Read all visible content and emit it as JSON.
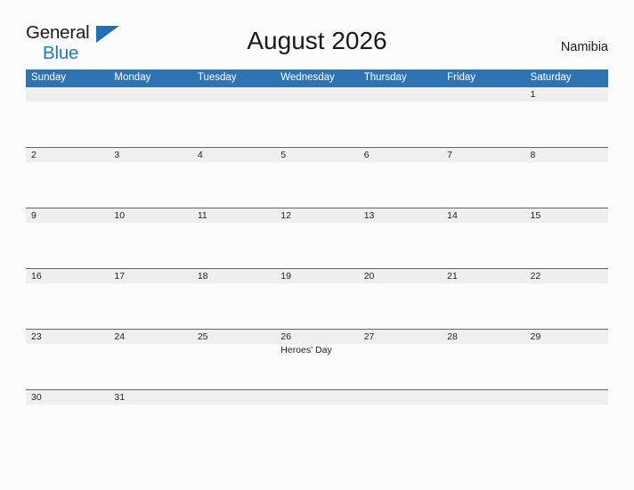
{
  "brand": {
    "word_one": "General",
    "word_two": "Blue"
  },
  "header": {
    "title": "August 2026",
    "country": "Namibia"
  },
  "colors": {
    "header_blue": "#2e74b5",
    "date_band_gray": "#efefef",
    "brand_blue": "#1f7ac4",
    "page_background": "#fcfcfd",
    "text": "#1e1e1e"
  },
  "weekdays": [
    "Sunday",
    "Monday",
    "Tuesday",
    "Wednesday",
    "Thursday",
    "Friday",
    "Saturday"
  ],
  "weeks": [
    {
      "days": [
        {
          "date": "",
          "event": ""
        },
        {
          "date": "",
          "event": ""
        },
        {
          "date": "",
          "event": ""
        },
        {
          "date": "",
          "event": ""
        },
        {
          "date": "",
          "event": ""
        },
        {
          "date": "",
          "event": ""
        },
        {
          "date": "1",
          "event": ""
        }
      ]
    },
    {
      "days": [
        {
          "date": "2",
          "event": ""
        },
        {
          "date": "3",
          "event": ""
        },
        {
          "date": "4",
          "event": ""
        },
        {
          "date": "5",
          "event": ""
        },
        {
          "date": "6",
          "event": ""
        },
        {
          "date": "7",
          "event": ""
        },
        {
          "date": "8",
          "event": ""
        }
      ]
    },
    {
      "days": [
        {
          "date": "9",
          "event": ""
        },
        {
          "date": "10",
          "event": ""
        },
        {
          "date": "11",
          "event": ""
        },
        {
          "date": "12",
          "event": ""
        },
        {
          "date": "13",
          "event": ""
        },
        {
          "date": "14",
          "event": ""
        },
        {
          "date": "15",
          "event": ""
        }
      ]
    },
    {
      "days": [
        {
          "date": "16",
          "event": ""
        },
        {
          "date": "17",
          "event": ""
        },
        {
          "date": "18",
          "event": ""
        },
        {
          "date": "19",
          "event": ""
        },
        {
          "date": "20",
          "event": ""
        },
        {
          "date": "21",
          "event": ""
        },
        {
          "date": "22",
          "event": ""
        }
      ]
    },
    {
      "days": [
        {
          "date": "23",
          "event": ""
        },
        {
          "date": "24",
          "event": ""
        },
        {
          "date": "25",
          "event": ""
        },
        {
          "date": "26",
          "event": "Heroes' Day"
        },
        {
          "date": "27",
          "event": ""
        },
        {
          "date": "28",
          "event": ""
        },
        {
          "date": "29",
          "event": ""
        }
      ]
    },
    {
      "days": [
        {
          "date": "30",
          "event": ""
        },
        {
          "date": "31",
          "event": ""
        },
        {
          "date": "",
          "event": ""
        },
        {
          "date": "",
          "event": ""
        },
        {
          "date": "",
          "event": ""
        },
        {
          "date": "",
          "event": ""
        },
        {
          "date": "",
          "event": ""
        }
      ]
    }
  ]
}
